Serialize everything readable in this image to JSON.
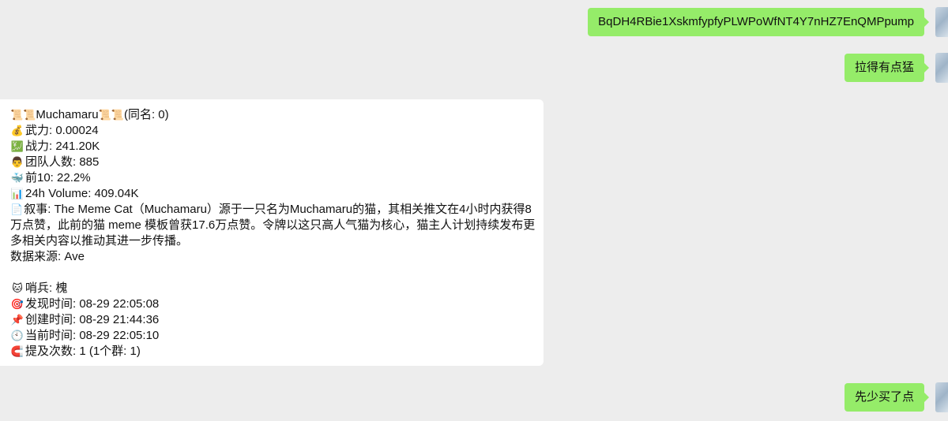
{
  "messages": {
    "out1": "BqDH4RBie1XskmfypfyPLWPoWfNT4Y7nHZ7EnQMPpump",
    "out2": "拉得有点猛",
    "out3": "先少买了点"
  },
  "card": {
    "title_prefix": "📜📜",
    "title_name": "Muchamaru",
    "title_suffix_icons": "📜📜",
    "title_extra": "(同名: 0)",
    "rows": [
      {
        "icon": "💰",
        "text": "武力: 0.00024"
      },
      {
        "icon": "💹",
        "text": "战力: 241.20K"
      },
      {
        "icon": "👨",
        "text": "团队人数: 885"
      },
      {
        "icon": "🐳",
        "text": "前10: 22.2%"
      },
      {
        "icon": "📊",
        "text": "24h Volume: 409.04K"
      }
    ],
    "story_icon": "📄",
    "story": "叙事: The Meme Cat（Muchamaru）源于一只名为Muchamaru的猫，其相关推文在4小时内获得8万点赞，此前的猫 meme 模板曾获17.6万点赞。令牌以这只高人气猫为核心，猫主人计划持续发布更多相关内容以推动其进一步传播。",
    "source": "数据来源: Ave",
    "rows2": [
      {
        "icon": "🐱",
        "text": "哨兵: 槐"
      },
      {
        "icon": "🎯",
        "text": "发现时间: 08-29 22:05:08"
      },
      {
        "icon": "📌",
        "text": "创建时间: 08-29 21:44:36"
      },
      {
        "icon": "🕙",
        "text": "当前时间: 08-29 22:05:10"
      },
      {
        "icon": "🧲",
        "text": "提及次数: 1 (1个群: 1)"
      }
    ]
  }
}
